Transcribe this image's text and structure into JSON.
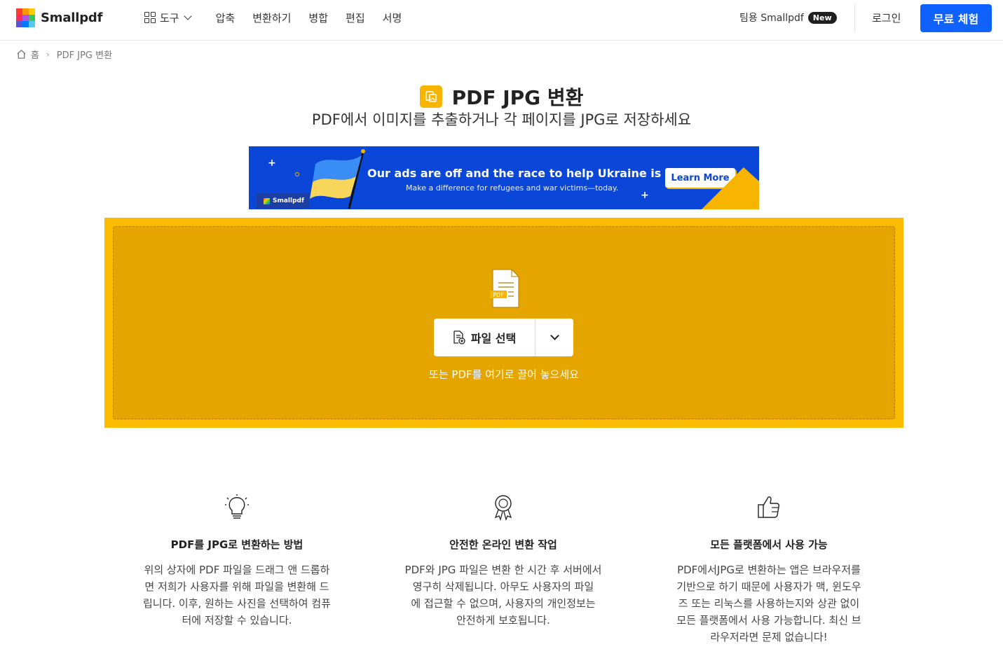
{
  "header": {
    "logo_text": "Smallpdf",
    "nav": {
      "tools": "도구",
      "compress": "압축",
      "convert": "변환하기",
      "merge": "병합",
      "edit": "편집",
      "sign": "서명"
    },
    "team": "팀용 Smallpdf",
    "new_badge": "New",
    "login": "로그인",
    "trial": "무료 체험"
  },
  "breadcrumb": {
    "home": "홈",
    "current": "PDF JPG 변환"
  },
  "hero": {
    "title": "PDF JPG 변환",
    "subtitle": "PDF에서 이미지를 추출하거나 각 페이지를 JPG로 저장하세요"
  },
  "banner": {
    "headline": "Our ads are off and the race to help Ukraine is on",
    "sub": "Make a difference for refugees and war victims—today.",
    "cta": "Learn More",
    "brand": "Smallpdf"
  },
  "dropzone": {
    "pdf_label": "PDF",
    "select_label": "파일 선택",
    "hint": "또는 PDF를 여기로 끌어 놓으세요"
  },
  "features": [
    {
      "icon": "lightbulb-icon",
      "title": "PDF를 JPG로 변환하는 방법",
      "lines": [
        "위의 상자에 PDF 파일을 드래그 앤 드롭하",
        "면 저희가 사용자를 위해 파일을 변환해 드",
        "립니다. 이후, 원하는 사진을 선택하여 컴퓨",
        "터에 저장할 수 있습니다."
      ]
    },
    {
      "icon": "award-icon",
      "title": "안전한 온라인 변환 작업",
      "lines": [
        "PDF와 JPG 파일은 변환 한 시간 후 서버에서",
        "영구히 삭제됩니다. 아무도 사용자의 파일",
        "에 접근할 수 없으며, 사용자의 개인정보는",
        "안전하게 보호됩니다."
      ]
    },
    {
      "icon": "thumbs-up-icon",
      "title": "모든 플랫폼에서 사용 가능",
      "lines": [
        "PDF에서JPG로 변환하는 앱은 브라우저를",
        "기반으로 하기 때문에 사용자가 맥, 윈도우",
        "즈 또는 리눅스를 사용하는지와 상관 없이",
        "모든 플랫폼에서 사용 가능합니다. 최신 브",
        "라우저라면 문제 없습니다!"
      ]
    }
  ],
  "colors": {
    "primary": "#0f62fe",
    "dropzone_outer": "#fbbb00",
    "dropzone_inner": "#e5a500",
    "banner_blue": "#0a46d8"
  }
}
